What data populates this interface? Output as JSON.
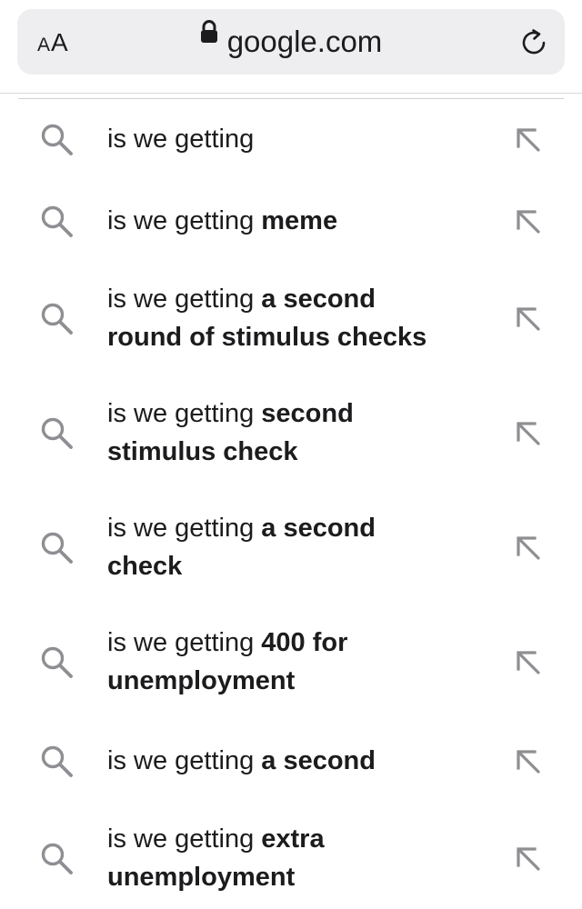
{
  "address_bar": {
    "text_size_label_small": "A",
    "text_size_label_large": "A",
    "url": "google.com",
    "lock_icon": "lock-icon",
    "reload_icon": "reload-icon"
  },
  "suggestions": [
    {
      "prefix": "is we getting",
      "completion_line1": "",
      "completion_line2": "",
      "search_icon": "search-icon",
      "fill_icon": "arrow-up-left-icon"
    },
    {
      "prefix": "is we getting",
      "completion_line1": "meme",
      "completion_line2": "",
      "search_icon": "search-icon",
      "fill_icon": "arrow-up-left-icon"
    },
    {
      "prefix": "is we getting",
      "completion_line1": "a second",
      "completion_line2": "round of stimulus checks",
      "search_icon": "search-icon",
      "fill_icon": "arrow-up-left-icon"
    },
    {
      "prefix": "is we getting",
      "completion_line1": "second",
      "completion_line2": "stimulus check",
      "search_icon": "search-icon",
      "fill_icon": "arrow-up-left-icon"
    },
    {
      "prefix": "is we getting",
      "completion_line1": "a second",
      "completion_line2": "check",
      "search_icon": "search-icon",
      "fill_icon": "arrow-up-left-icon"
    },
    {
      "prefix": "is we getting",
      "completion_line1": "400 for",
      "completion_line2": "unemployment",
      "search_icon": "search-icon",
      "fill_icon": "arrow-up-left-icon"
    },
    {
      "prefix": "is we getting",
      "completion_line1": "a second",
      "completion_line2": "",
      "search_icon": "search-icon",
      "fill_icon": "arrow-up-left-icon"
    },
    {
      "prefix": "is we getting",
      "completion_line1": "extra",
      "completion_line2": "unemployment",
      "search_icon": "search-icon",
      "fill_icon": "arrow-up-left-icon"
    }
  ],
  "colors": {
    "text": "#1c1c1e",
    "icon_gray": "#8e8e93",
    "pill_background": "#eeeef0"
  }
}
